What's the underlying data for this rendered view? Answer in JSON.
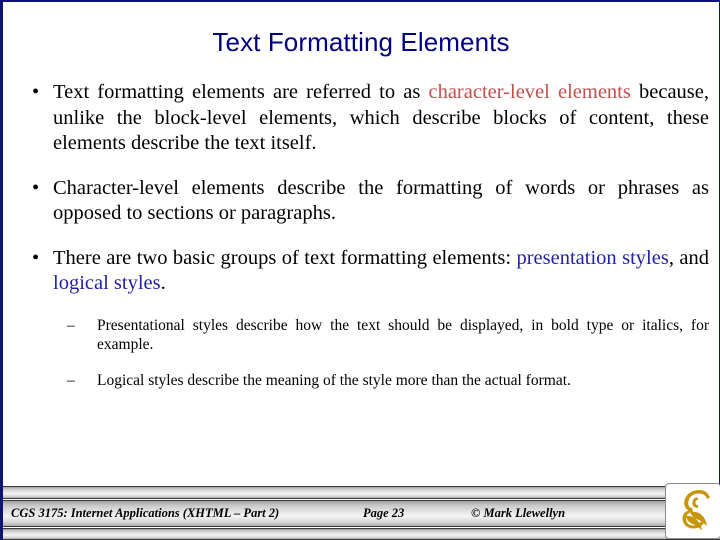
{
  "slide": {
    "title": "Text Formatting Elements",
    "title_color": "#000080",
    "background_color": "#FFFFFF",
    "border_color": "#11117A",
    "accent_red": "#C0504D",
    "accent_blue": "#2222A8"
  },
  "bullets": [
    {
      "marker": "•",
      "segments": [
        {
          "text": "Text formatting elements are referred to as ",
          "style": "normal"
        },
        {
          "text": "character-level elements",
          "style": "red"
        },
        {
          "text": " because, unlike the block-level elements, which describe blocks of content, these elements describe the text itself.",
          "style": "normal"
        }
      ]
    },
    {
      "marker": "•",
      "segments": [
        {
          "text": "Character-level elements describe the formatting of words or phrases as opposed to sections or paragraphs.",
          "style": "normal"
        }
      ]
    },
    {
      "marker": "•",
      "segments": [
        {
          "text": "There are two basic groups of text formatting elements: ",
          "style": "normal"
        },
        {
          "text": "presentation styles",
          "style": "blue"
        },
        {
          "text": ", and ",
          "style": "normal"
        },
        {
          "text": "logical styles",
          "style": "blue"
        },
        {
          "text": ".",
          "style": "normal"
        }
      ]
    }
  ],
  "sub_bullets": [
    {
      "marker": "–",
      "text": "Presentational styles describe how the text should be displayed, in bold type or italics, for example."
    },
    {
      "marker": "–",
      "text": "Logical styles describe the meaning of the style more than the actual format."
    }
  ],
  "footer": {
    "course": "CGS 3175: Internet Applications (XHTML – Part 2)",
    "page": "Page 23",
    "copyright": "© Mark Llewellyn",
    "logo_name": "ucf-pegasus-logo",
    "logo_color": "#C8960C"
  }
}
